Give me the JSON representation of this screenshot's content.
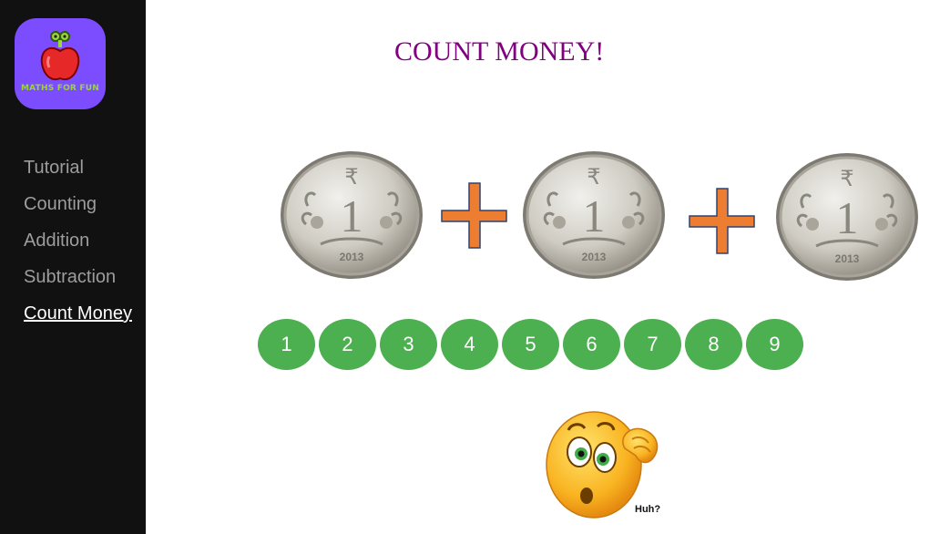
{
  "app": {
    "logo_text": "MATHS FOR FUN",
    "brand_color": "#7c4dff",
    "sidebar_bg": "#111111"
  },
  "nav": {
    "items": [
      {
        "label": "Tutorial",
        "active": false
      },
      {
        "label": "Counting",
        "active": false
      },
      {
        "label": "Addition",
        "active": false
      },
      {
        "label": "Subtraction",
        "active": false
      },
      {
        "label": "Count Money",
        "active": true
      }
    ]
  },
  "main": {
    "title": "COUNT MONEY!",
    "title_color": "#800080",
    "coins": [
      {
        "symbol": "₹",
        "value": "1",
        "year": "2013"
      },
      {
        "symbol": "₹",
        "value": "1",
        "year": "2013"
      },
      {
        "symbol": "₹",
        "value": "1",
        "year": "2013"
      }
    ],
    "operator_color": "#ed7d31",
    "answer_options": [
      "1",
      "2",
      "3",
      "4",
      "5",
      "6",
      "7",
      "8",
      "9"
    ],
    "answer_button_color": "#4caf50",
    "emoji": {
      "icon": "confused-thinking-emoji",
      "caption": "Huh?"
    }
  }
}
